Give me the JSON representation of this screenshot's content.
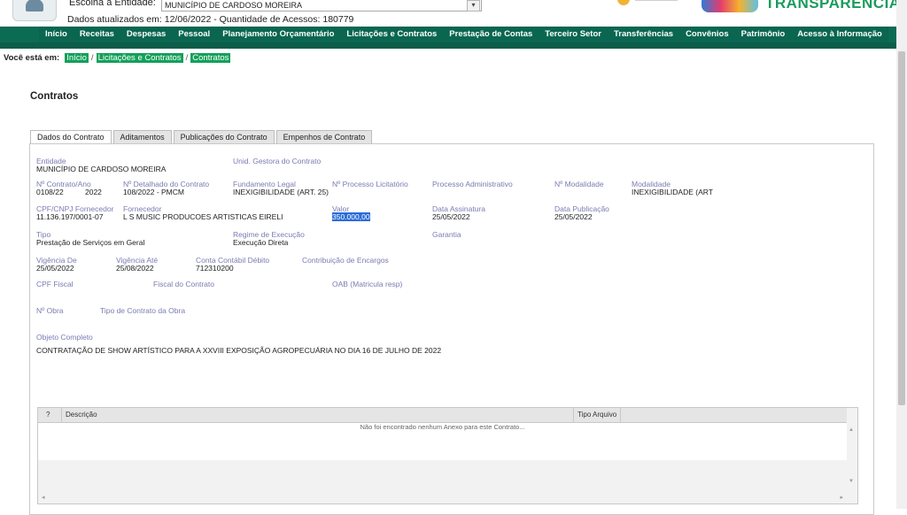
{
  "header": {
    "entity_label": "Escolha a Entidade:",
    "entity_value": "MUNICÍPIO DE CARDOSO MOREIRA",
    "updated_text": "Dados atualizados em: 12/06/2022 - Quantidade de Acessos: 180779",
    "brand": "TRANSPARÊNCIA"
  },
  "nav": [
    "Início",
    "Receitas",
    "Despesas",
    "Pessoal",
    "Planejamento Orçamentário",
    "Licitações e Contratos",
    "Prestação de Contas",
    "Terceiro Setor",
    "Transferências",
    "Convênios",
    "Patrimônio",
    "Acesso à Informação"
  ],
  "breadcrumb": {
    "prefix": "Você está em:",
    "items": [
      "Início",
      "Licitações e Contratos",
      "Contratos"
    ]
  },
  "page_title": "Contratos",
  "tabs": [
    "Dados do Contrato",
    "Aditamentos",
    "Publicações do Contrato",
    "Empenhos de Contrato"
  ],
  "fields": {
    "entidade": {
      "label": "Entidade",
      "value": "MUNICÍPIO DE CARDOSO MOREIRA"
    },
    "unid_gestora": {
      "label": "Unid. Gestora do Contrato",
      "value": ""
    },
    "num_contrato": {
      "label": "Nº Contrato/Ano",
      "value": "0108/22",
      "value2": "2022"
    },
    "num_detalhado": {
      "label": "Nº Detalhado do Contrato",
      "value": "108/2022 - PMCM"
    },
    "fundamento": {
      "label": "Fundamento Legal",
      "value": "INEXIGIBILIDADE (ART. 25)"
    },
    "processo_licitatorio": {
      "label": "Nº Processo Licitatório",
      "value": ""
    },
    "processo_adm": {
      "label": "Processo Administrativo",
      "value": ""
    },
    "num_modalidade": {
      "label": "Nº Modalidade",
      "value": ""
    },
    "modalidade": {
      "label": "Modalidade",
      "value": "INEXIGIBILIDADE (ART"
    },
    "cpf_cnpj": {
      "label": "CPF/CNPJ Fornecedor",
      "value": "11.136.197/0001-07"
    },
    "fornecedor": {
      "label": "Fornecedor",
      "value": "L S MUSIC PRODUCOES ARTISTICAS EIRELI"
    },
    "valor": {
      "label": "Valor",
      "value": "350.000,00"
    },
    "data_assinatura": {
      "label": "Data Assinatura",
      "value": "25/05/2022"
    },
    "data_publicacao": {
      "label": "Data Publicação",
      "value": "25/05/2022"
    },
    "tipo": {
      "label": "Tipo",
      "value": "Prestação de Serviços em Geral"
    },
    "regime": {
      "label": "Regime de Execução",
      "value": "Execução Direta"
    },
    "garantia": {
      "label": "Garantia",
      "value": ""
    },
    "vigencia_de": {
      "label": "Vigência De",
      "value": "25/05/2022"
    },
    "vigencia_ate": {
      "label": "Vigência Até",
      "value": "25/08/2022"
    },
    "conta_contabil": {
      "label": "Conta Contábil Débito",
      "value": "712310200"
    },
    "contribuicao": {
      "label": "Contribuição de Encargos",
      "value": ""
    },
    "cpf_fiscal": {
      "label": "CPF Fiscal",
      "value": ""
    },
    "fiscal": {
      "label": "Fiscal do Contrato",
      "value": ""
    },
    "oab": {
      "label": "OAB (Matricula resp)",
      "value": ""
    },
    "num_obra": {
      "label": "Nº Obra",
      "value": ""
    },
    "tipo_obra": {
      "label": "Tipo de Contrato da Obra",
      "value": ""
    },
    "objeto": {
      "label": "Objeto Completo",
      "value": "CONTRATAÇÃO DE SHOW ARTÍSTICO PARA A XXVIII EXPOSIÇÃO AGROPECUÁRIA NO DIA 16 DE JULHO DE 2022"
    }
  },
  "attachments": {
    "col_q": "?",
    "col_desc": "Descrição",
    "col_tipo": "Tipo Arquivo",
    "empty_text": "Não foi encontrado nenhum Anexo para este Contrato..."
  },
  "colors": {
    "nav_bg": "#0c6b53",
    "brand": "#1a9b5c",
    "label": "#7b7bb3",
    "highlight": "#2b6cd6"
  }
}
